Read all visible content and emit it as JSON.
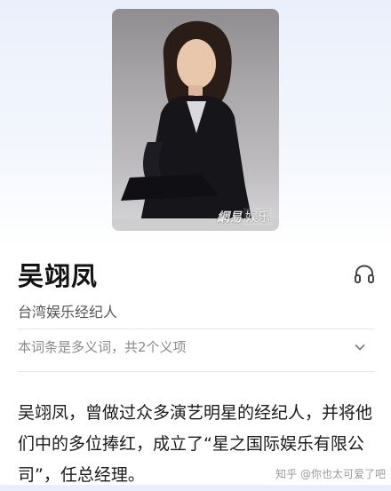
{
  "entry": {
    "title": "吴翊凤",
    "subtitle": "台湾娱乐经纪人",
    "disambiguation": "本词条是多义词，共2个义项",
    "summary": "吴翊凤，曾做过众多演艺明星的经纪人，并将他们中的多位捧红，成立了“星之国际娱乐有限公司”，任总经理。"
  },
  "photo": {
    "watermark_mark": "網易",
    "watermark_sub": "娱乐",
    "icon": "portrait-photo"
  },
  "icons": {
    "audio": "headphones-icon",
    "expand": "chevron-down-icon"
  },
  "watermark": {
    "platform": "知乎",
    "handle": "@你也太可爱了吧"
  },
  "colors": {
    "header_gradient_top": "#eaf0fb",
    "title": "#121212",
    "subtitle": "#555555",
    "muted": "#8a8a8a",
    "divider": "#e6e6e6"
  }
}
